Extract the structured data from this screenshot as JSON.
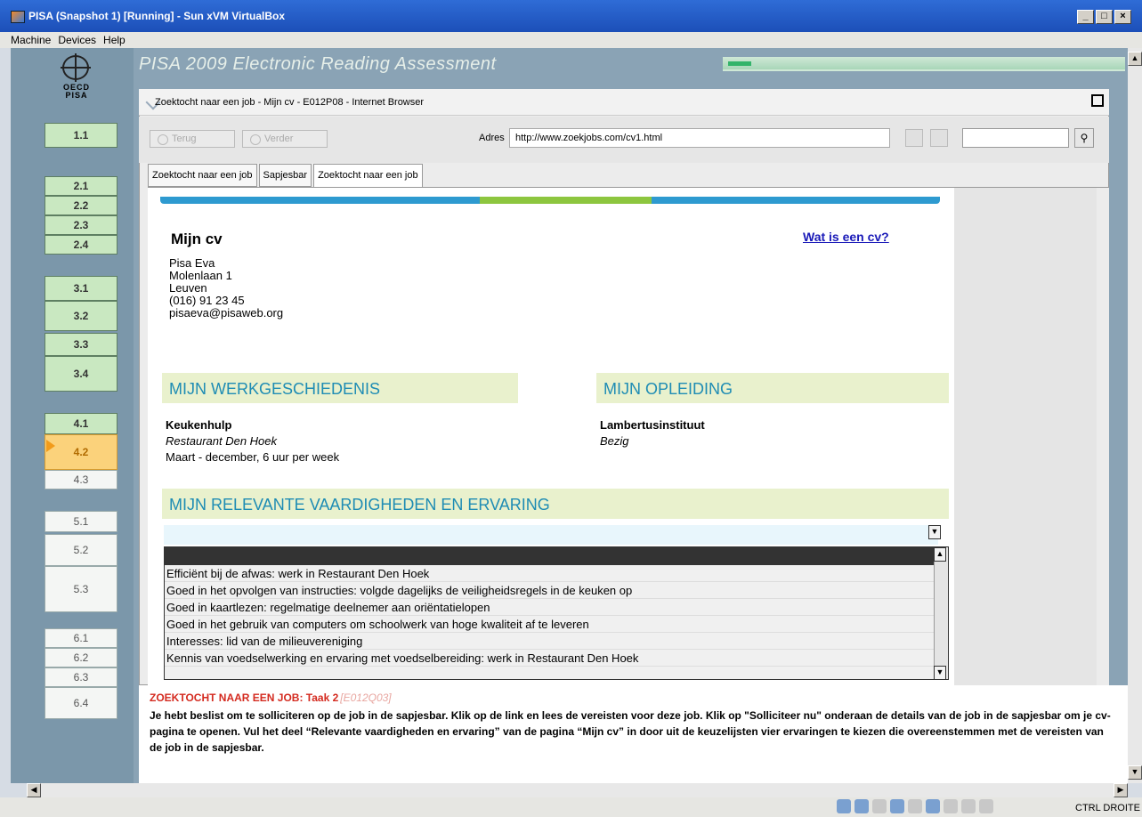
{
  "window": {
    "title": "PISA (Snapshot 1) [Running] - Sun xVM VirtualBox"
  },
  "menu": [
    "Machine",
    "Devices",
    "Help"
  ],
  "pisa": {
    "title": "PISA 2009 Electronic Reading Assessment",
    "logo_text": "OECD PISA",
    "progress_fraction": 0.06
  },
  "nav": {
    "groups": [
      [
        "1.1"
      ],
      [
        "2.1",
        "2.2",
        "2.3",
        "2.4"
      ],
      [
        "3.1",
        "3.2",
        "3.3",
        "3.4"
      ],
      [
        "4.1",
        "4.2",
        "4.3"
      ],
      [
        "5.1",
        "5.2",
        "5.3"
      ],
      [
        "6.1",
        "6.2",
        "6.3",
        "6.4"
      ]
    ],
    "active": "4.2"
  },
  "browser": {
    "title": "Zoektocht naar een job - Mijn cv - E012P08 - Internet Browser",
    "back_label": "Terug",
    "forward_label": "Verder",
    "address_label": "Adres",
    "url": "http://www.zoekjobs.com/cv1.html",
    "tabs": [
      "Zoektocht naar een job",
      "Sapjesbar",
      "Zoektocht naar een job"
    ]
  },
  "cv": {
    "title": "Mijn cv",
    "help_link": "Wat is een cv?",
    "name": "Pisa Eva",
    "street": "Molenlaan 1",
    "city": "Leuven",
    "phone": "(016) 91 23 45",
    "email": "pisaeva@pisaweb.org",
    "work_heading": "MIJN WERKGESCHIEDENIS",
    "edu_heading": "MIJN OPLEIDING",
    "job_title": "Keukenhulp",
    "job_place": "Restaurant Den Hoek",
    "job_period": "Maart - december, 6 uur per week",
    "school": "Lambertusinstituut",
    "school_status": "Bezig",
    "skills_heading": "MIJN RELEVANTE VAARDIGHEDEN EN ERVARING",
    "options": [
      "Efficiënt bij de afwas: werk in Restaurant Den Hoek",
      "Goed in het opvolgen van instructies: volgde dagelijks de veiligheidsregels in de keuken op",
      "Goed in kaartlezen: regelmatige deelnemer aan oriëntatielopen",
      "Goed in het gebruik van computers om schoolwerk van hoge kwaliteit af te leveren",
      "Interesses: lid van de milieuvereniging",
      "Kennis van voedselwerking en ervaring met voedselbereiding: werk in Restaurant Den Hoek"
    ]
  },
  "task": {
    "title": "ZOEKTOCHT NAAR EEN JOB: Taak 2",
    "code": "[E012Q03]",
    "text": "Je hebt beslist om te solliciteren op de job in de sapjesbar. Klik op de link en lees de vereisten voor deze job. Klik op \"Solliciteer nu\" onderaan de details van de job in de sapjesbar om je cv-pagina te openen. Vul het deel “Relevante vaardigheden en ervaring” van de pagina “Mijn cv” in door uit de keuzelijsten vier ervaringen te kiezen die overeenstemmen met de vereisten van de job in de sapjesbar."
  },
  "status": {
    "host_key": "CTRL DROITE"
  }
}
